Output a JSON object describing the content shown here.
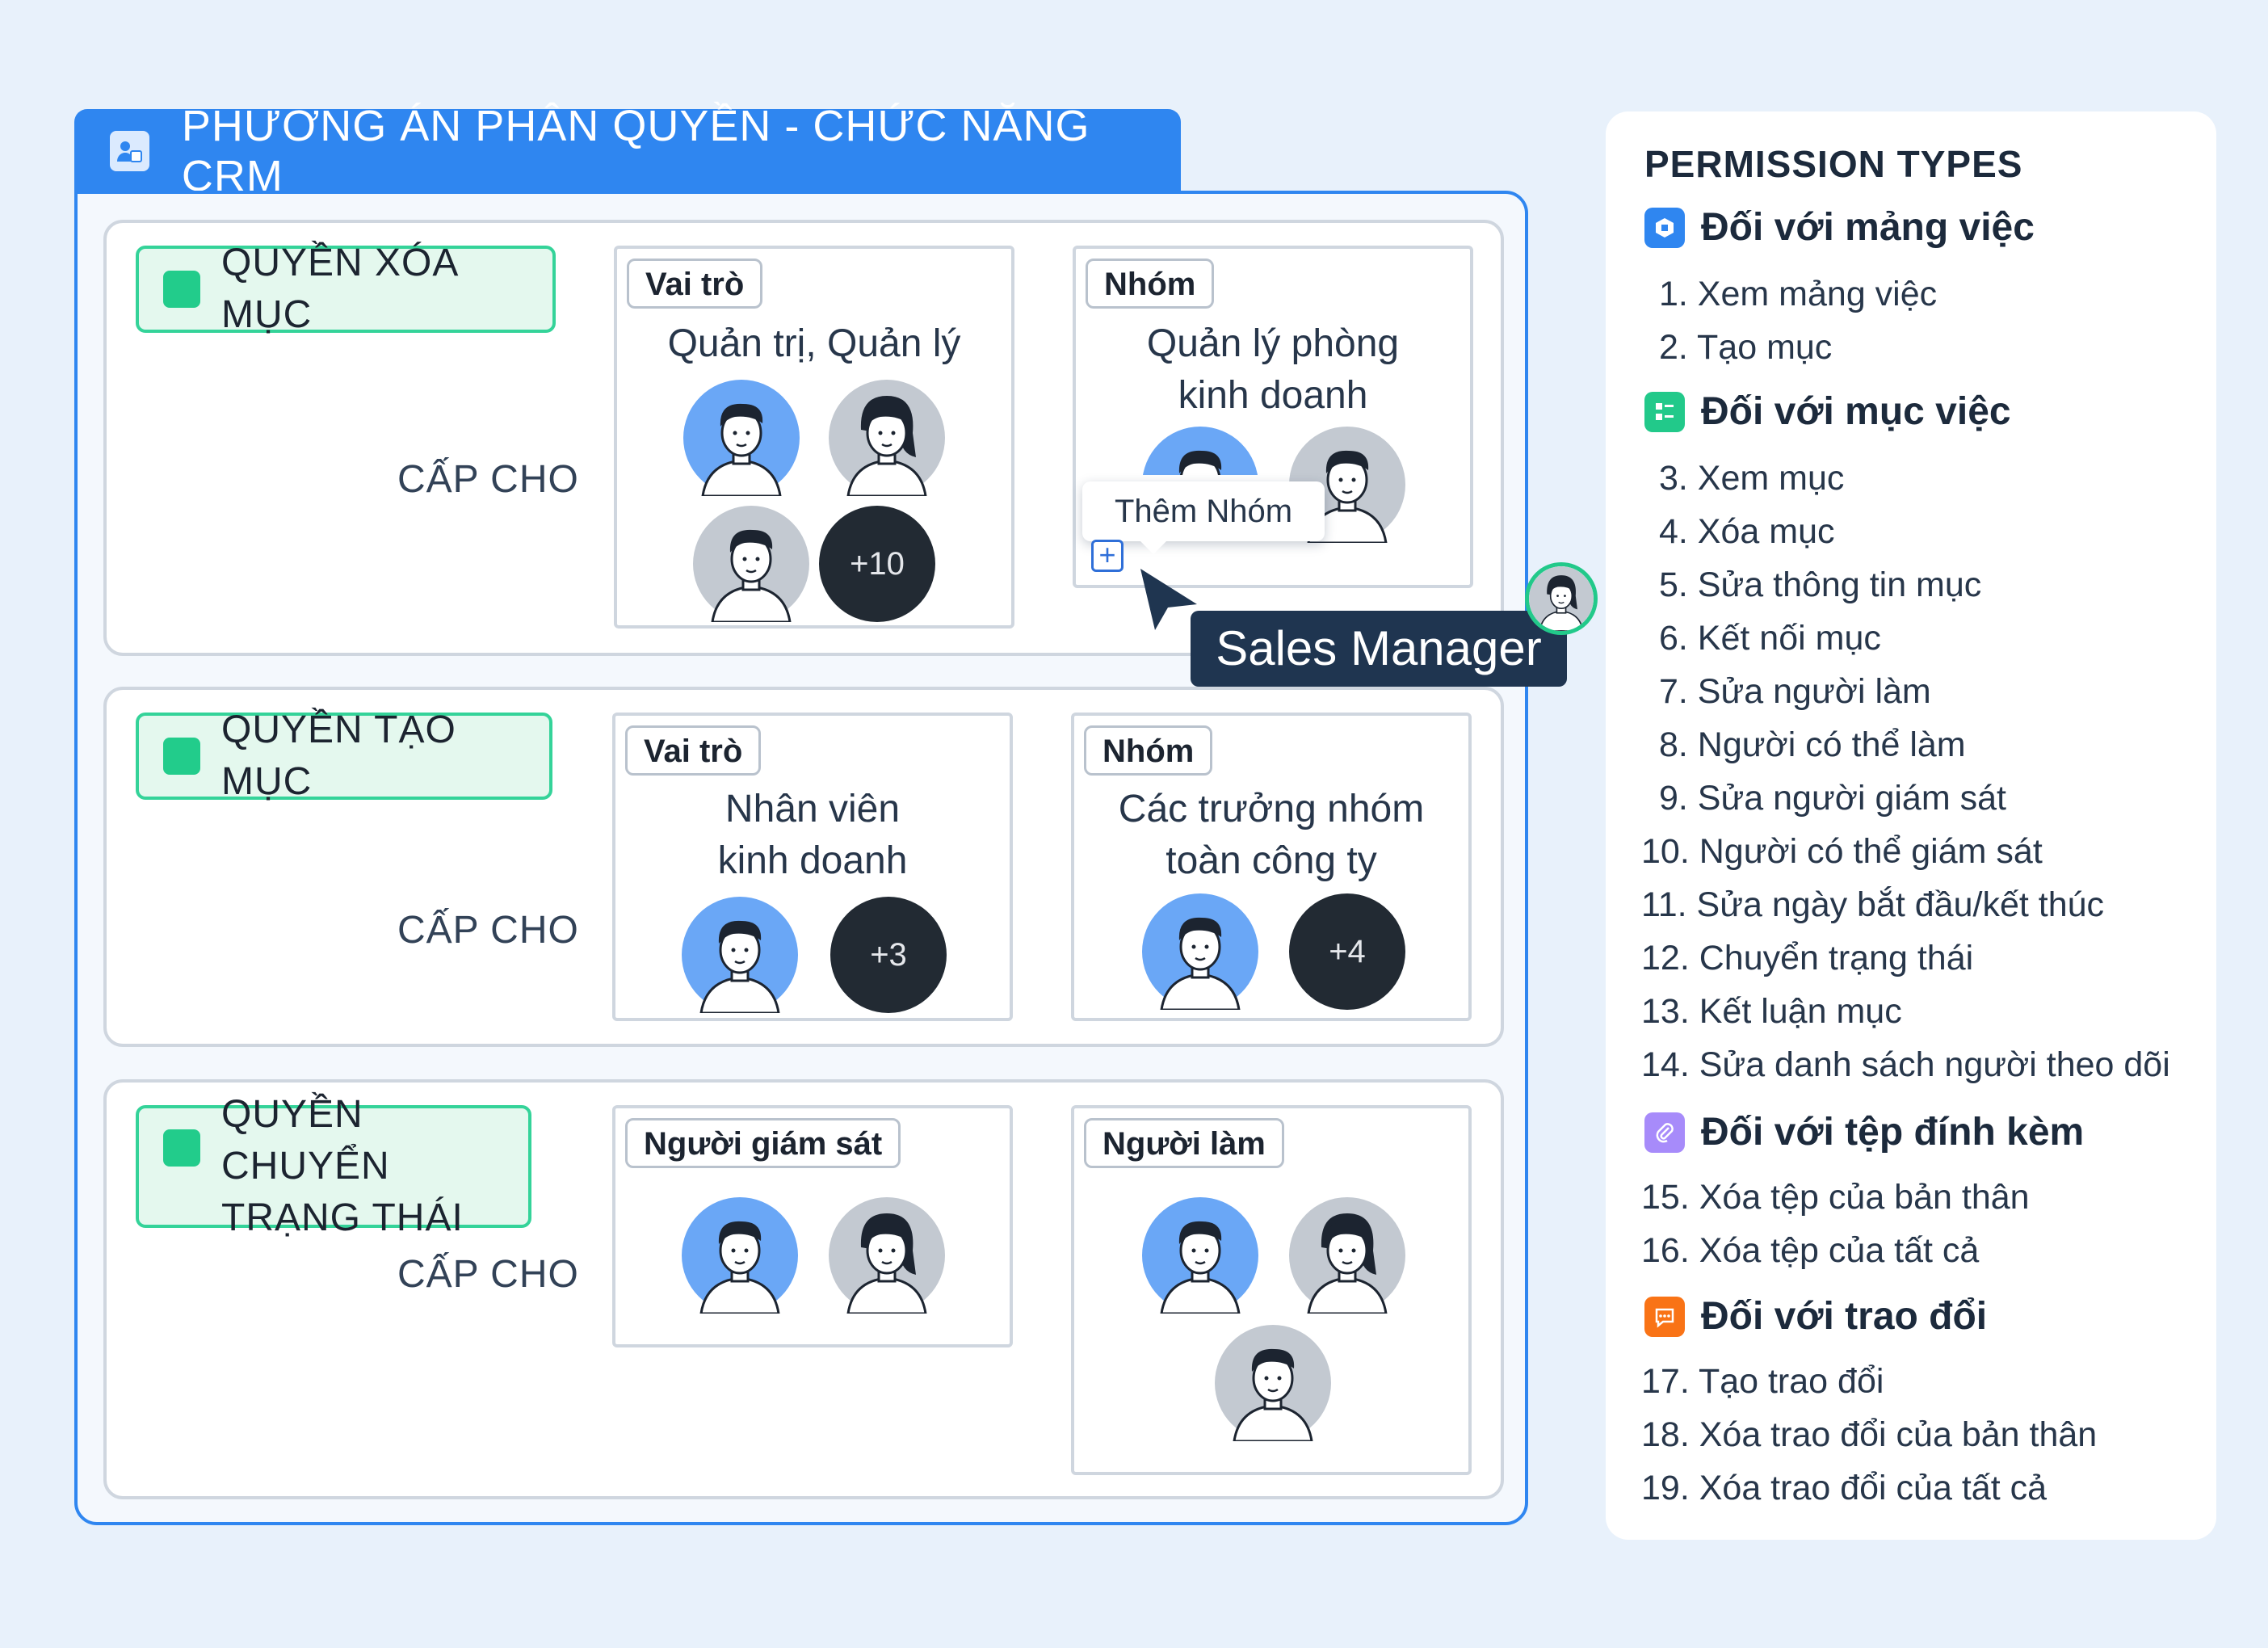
{
  "title": "PHƯƠNG ÁN PHÂN QUYỀN - CHỨC NĂNG CRM",
  "grant_label": "CẤP CHO",
  "sections": [
    {
      "permission": "QUYỀN XÓA MỤC",
      "left_chip": "Vai trò",
      "left_text": "Quản trị, Quản lý",
      "left_more": "+10",
      "right_chip": "Nhóm",
      "right_text_1": "Quản lý phòng",
      "right_text_2": "kinh doanh"
    },
    {
      "permission": "QUYỀN TẠO MỤC",
      "left_chip": "Vai trò",
      "left_text_1": "Nhân viên",
      "left_text_2": "kinh doanh",
      "left_more": "+3",
      "right_chip": "Nhóm",
      "right_text_1": "Các trưởng nhóm",
      "right_text_2": "toàn công ty",
      "right_more": "+4"
    },
    {
      "permission_1": "QUYỀN CHUYỂN",
      "permission_2": "TRẠNG THÁI",
      "left_chip": "Người giám sát",
      "right_chip": "Người làm"
    }
  ],
  "tooltip": "Thêm Nhóm",
  "add_button": "+",
  "cursor_badge": "Sales Manager",
  "legend": {
    "title": "PERMISSION TYPES",
    "groups": [
      {
        "heading": "Đối với mảng việc",
        "icon": "workspace-icon",
        "color": "#2f86f0",
        "items": [
          "1. Xem mảng việc",
          "2. Tạo mục"
        ]
      },
      {
        "heading": "Đối với mục việc",
        "icon": "task-list-icon",
        "color": "#22c98a",
        "items": [
          "3. Xem mục",
          "4. Xóa mục",
          "5. Sửa thông tin mục",
          "6. Kết nối mục",
          "7. Sửa người làm",
          "8. Người có thể làm",
          "9. Sửa người giám sát",
          "10. Người có thể giám sát",
          "11. Sửa ngày bắt đầu/kết thúc",
          "12. Chuyển trạng thái",
          "13. Kết luận mục",
          "14. Sửa danh sách người theo dõi"
        ]
      },
      {
        "heading": "Đối với tệp đính kèm",
        "icon": "paperclip-icon",
        "color": "#a78bfa",
        "items": [
          "15. Xóa tệp của bản thân",
          "16. Xóa tệp của tất cả"
        ]
      },
      {
        "heading": "Đối với trao đổi",
        "icon": "chat-icon",
        "color": "#f97316",
        "items": [
          "17. Tạo trao đổi",
          "18. Xóa trao đổi của bản thân",
          "19. Xóa trao đổi của tất cả"
        ]
      }
    ]
  }
}
